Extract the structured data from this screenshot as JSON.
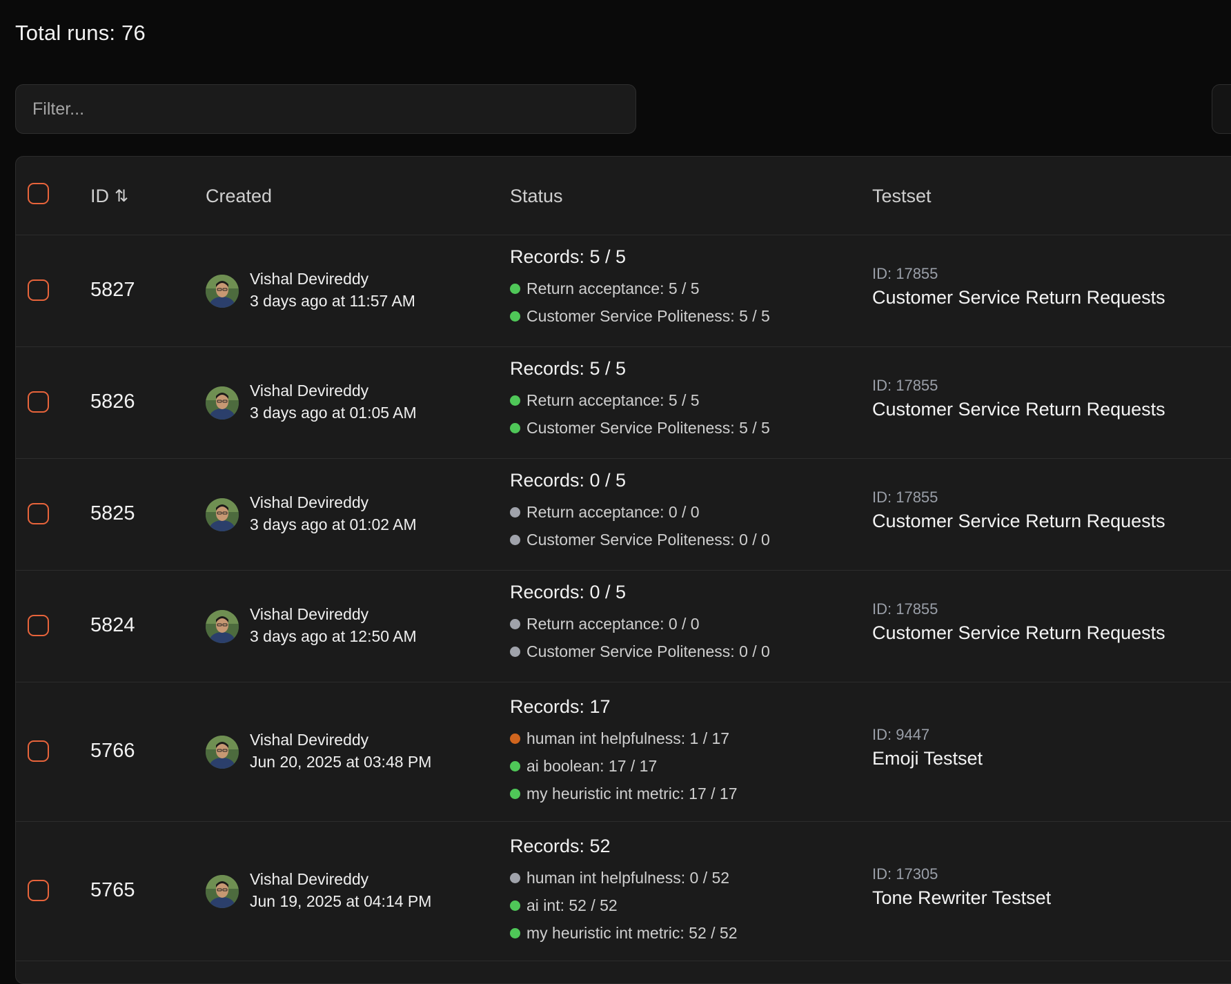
{
  "header": {
    "total_runs": "Total runs: 76"
  },
  "filter": {
    "placeholder": "Filter..."
  },
  "table": {
    "columns": {
      "id": "ID",
      "id_sort_icon": "⇅",
      "created": "Created",
      "status": "Status",
      "testset": "Testset"
    },
    "colors": {
      "checkbox_border": "#e8643b",
      "status_green": "#4fc758",
      "status_gray": "#a0a3ab",
      "status_orange": "#d0651e"
    },
    "rows": [
      {
        "id": "5827",
        "creator": "Vishal Devireddy",
        "created_at": "3 days ago at 11:57 AM",
        "records": "Records: 5 / 5",
        "metrics": [
          {
            "label": "Return acceptance: 5 / 5",
            "status": "green"
          },
          {
            "label": "Customer Service Politeness: 5 / 5",
            "status": "green"
          }
        ],
        "testset_id": "ID: 17855",
        "testset_name": "Customer Service Return Requests"
      },
      {
        "id": "5826",
        "creator": "Vishal Devireddy",
        "created_at": "3 days ago at 01:05 AM",
        "records": "Records: 5 / 5",
        "metrics": [
          {
            "label": "Return acceptance: 5 / 5",
            "status": "green"
          },
          {
            "label": "Customer Service Politeness: 5 / 5",
            "status": "green"
          }
        ],
        "testset_id": "ID: 17855",
        "testset_name": "Customer Service Return Requests"
      },
      {
        "id": "5825",
        "creator": "Vishal Devireddy",
        "created_at": "3 days ago at 01:02 AM",
        "records": "Records: 0 / 5",
        "metrics": [
          {
            "label": "Return acceptance: 0 / 0",
            "status": "gray"
          },
          {
            "label": "Customer Service Politeness: 0 / 0",
            "status": "gray"
          }
        ],
        "testset_id": "ID: 17855",
        "testset_name": "Customer Service Return Requests"
      },
      {
        "id": "5824",
        "creator": "Vishal Devireddy",
        "created_at": "3 days ago at 12:50 AM",
        "records": "Records: 0 / 5",
        "metrics": [
          {
            "label": "Return acceptance: 0 / 0",
            "status": "gray"
          },
          {
            "label": "Customer Service Politeness: 0 / 0",
            "status": "gray"
          }
        ],
        "testset_id": "ID: 17855",
        "testset_name": "Customer Service Return Requests"
      },
      {
        "id": "5766",
        "creator": "Vishal Devireddy",
        "created_at": "Jun 20, 2025 at 03:48 PM",
        "records": "Records: 17",
        "metrics": [
          {
            "label": "human int helpfulness: 1 / 17",
            "status": "orange"
          },
          {
            "label": "ai boolean: 17 / 17",
            "status": "green"
          },
          {
            "label": "my heuristic int metric: 17 / 17",
            "status": "green"
          }
        ],
        "testset_id": "ID: 9447",
        "testset_name": "Emoji Testset"
      },
      {
        "id": "5765",
        "creator": "Vishal Devireddy",
        "created_at": "Jun 19, 2025 at 04:14 PM",
        "records": "Records: 52",
        "metrics": [
          {
            "label": "human int helpfulness: 0 / 52",
            "status": "gray"
          },
          {
            "label": "ai int: 52 / 52",
            "status": "green"
          },
          {
            "label": "my heuristic int metric: 52 / 52",
            "status": "green"
          }
        ],
        "testset_id": "ID: 17305",
        "testset_name": "Tone Rewriter Testset"
      }
    ]
  }
}
